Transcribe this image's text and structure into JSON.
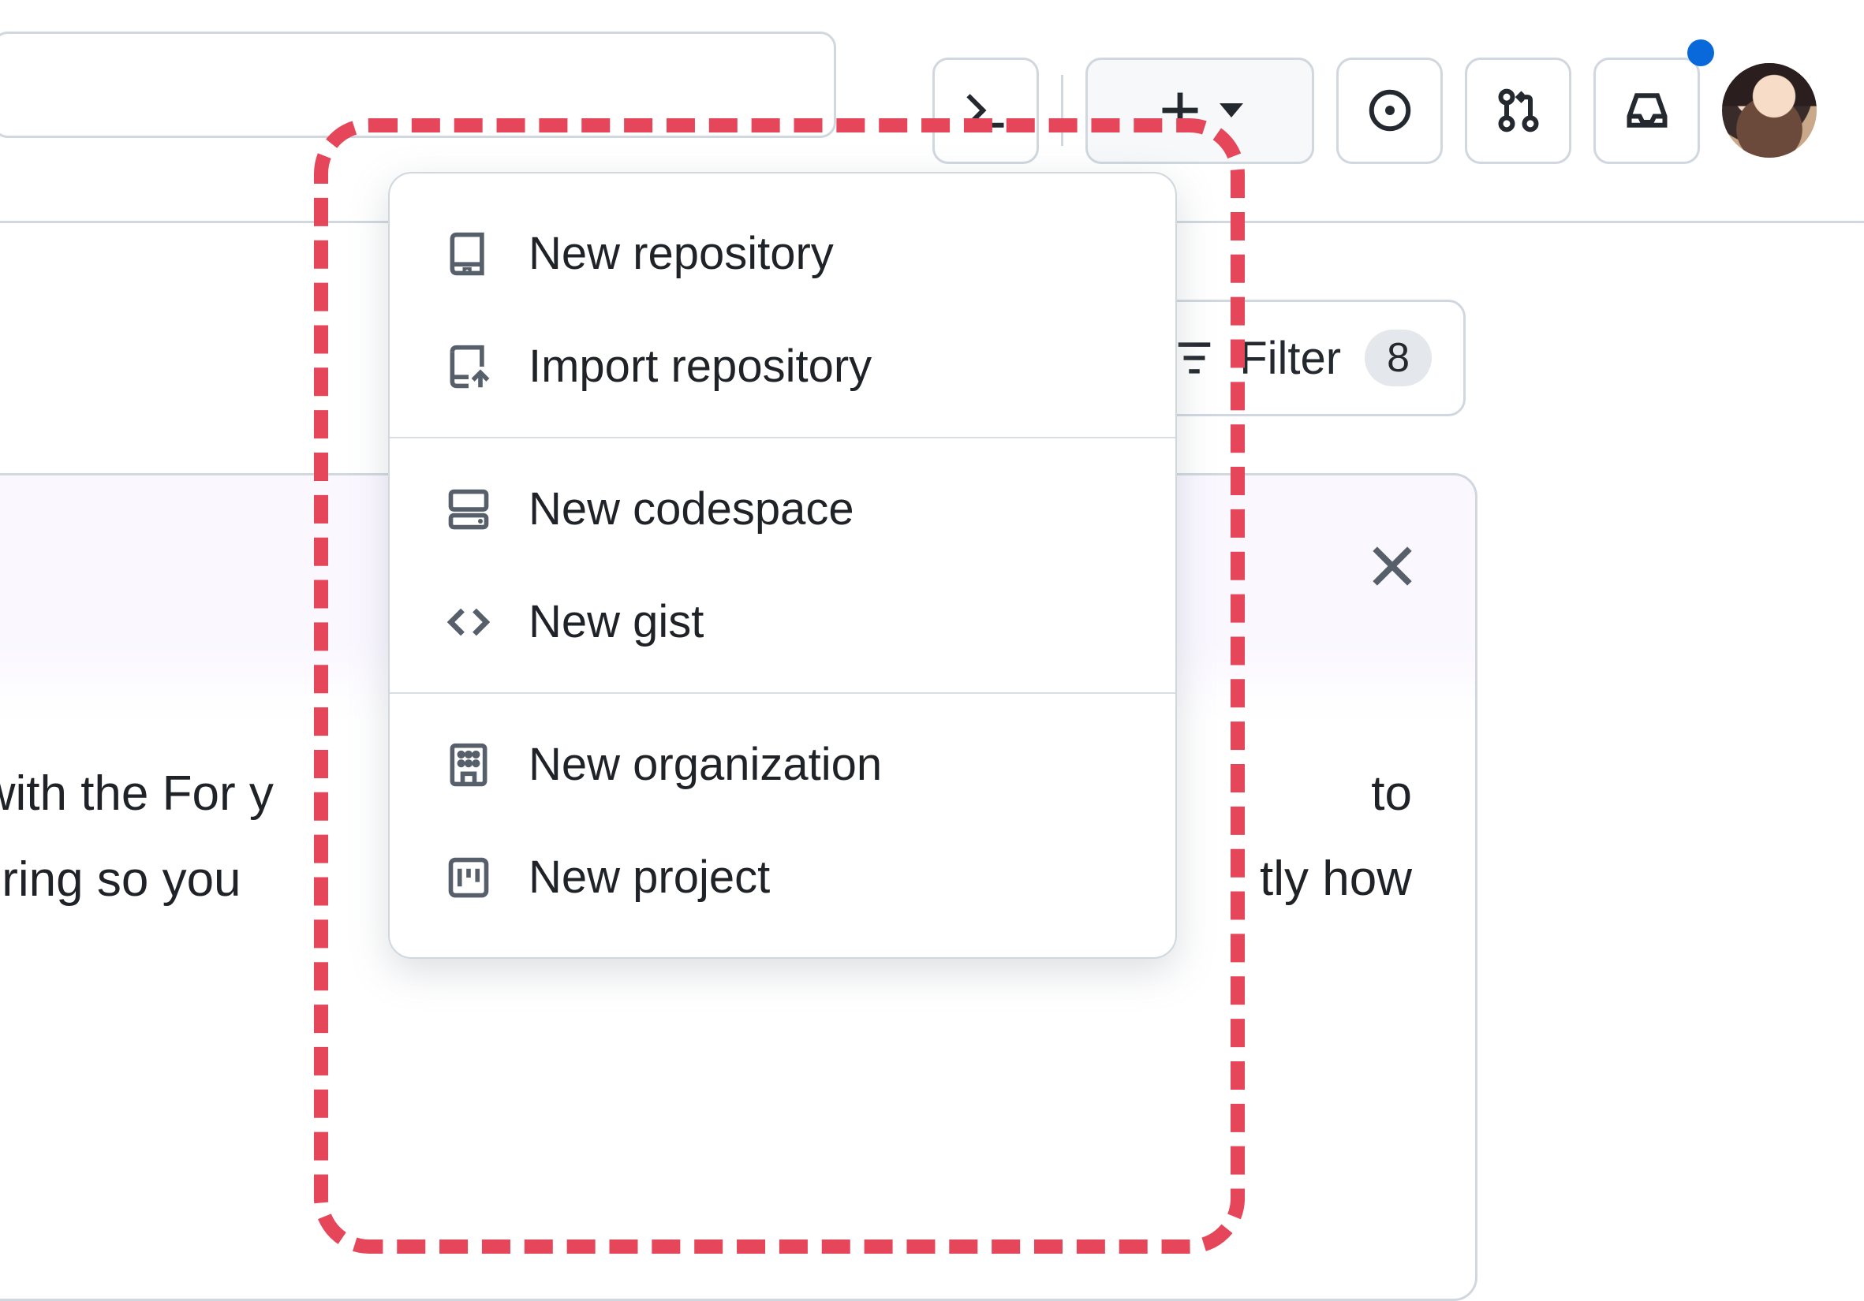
{
  "toolbar": {
    "search_placeholder": "",
    "create_menu_open": true
  },
  "filter": {
    "label": "Filter",
    "count": "8"
  },
  "card": {
    "body_line1": "d with the For y",
    "body_line2": "iltering so you",
    "body_line3": "to",
    "body_line4": "tly how"
  },
  "create_menu": {
    "groups": [
      [
        {
          "icon": "repo-icon",
          "label": "New repository"
        },
        {
          "icon": "repo-push-icon",
          "label": "Import repository"
        }
      ],
      [
        {
          "icon": "codespaces-icon",
          "label": "New codespace"
        },
        {
          "icon": "code-icon",
          "label": "New gist"
        }
      ],
      [
        {
          "icon": "organization-icon",
          "label": "New organization"
        },
        {
          "icon": "project-icon",
          "label": "New project"
        }
      ]
    ]
  }
}
